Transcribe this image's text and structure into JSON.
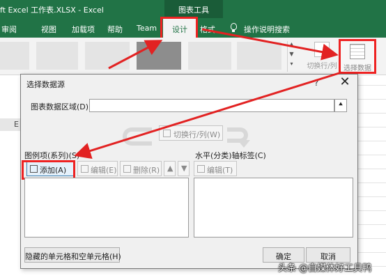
{
  "window": {
    "doc_title": "ft Excel 工作表.XLSX  -  Excel",
    "context_tab": "图表工具"
  },
  "ribbon_tabs": {
    "review": "审阅",
    "view": "视图",
    "addins": "加载项",
    "help": "帮助",
    "team": "Team",
    "design": "设计",
    "format": "格式",
    "tell_me": "操作说明搜索"
  },
  "ribbon": {
    "switch_row_col": "切换行/列",
    "select_data": "选择数据",
    "icons": {
      "lightbulb": "lightbulb-icon",
      "switch": "switch-row-col-icon",
      "select_data": "select-data-icon"
    }
  },
  "sheet": {
    "column_header": "E"
  },
  "dialog": {
    "title": "选择数据源",
    "help": "?",
    "close": "✕",
    "range_label": "图表数据区域(D):",
    "range_value": "",
    "range_collapse": "⯅",
    "switch_label": "切换行/列(W)",
    "series_label": "图例项(系列)(S)",
    "add_label": "添加(A)",
    "edit_label": "编辑(E)",
    "delete_label": "删除(R)",
    "move_up": "▲",
    "move_down": "▼",
    "axis_label": "水平(分类)轴标签(C)",
    "axis_edit_label": "编辑(T)",
    "hidden_cells_label": "隐藏的单元格和空单元格(H)",
    "ok_label": "确定",
    "cancel_label": "取消"
  },
  "watermark": "头条 @自媒体好工具鸭",
  "colors": {
    "excel_green": "#217346",
    "highlight_red": "#e22222",
    "dialog_bg": "#f0f0f0"
  }
}
